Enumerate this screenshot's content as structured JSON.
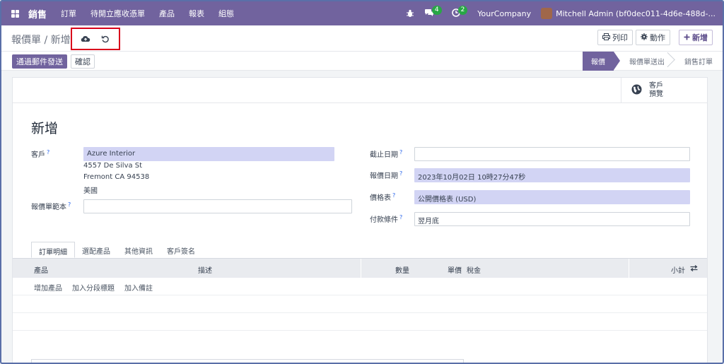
{
  "navbar": {
    "app_name": "銷售",
    "menu": [
      "訂單",
      "待開立應收憑單",
      "產品",
      "報表",
      "組態"
    ],
    "messages_count": "4",
    "activities_count": "2",
    "company": "YourCompany",
    "user": "Mitchell Admin (bf0dec011-4d6e-488d-..."
  },
  "breadcrumb": {
    "parent": "報價單",
    "separator": "/",
    "current": "新增"
  },
  "toolbar": {
    "print_label": "列印",
    "action_label": "動作",
    "new_label": "新增"
  },
  "actions": {
    "send_email_label": "通過郵件發送",
    "confirm_label": "確認"
  },
  "statusbar": {
    "stages": [
      "報價",
      "報價單送出",
      "銷售訂單"
    ],
    "active": "報價"
  },
  "smart_button": {
    "line1": "客戶",
    "line2": "預覽"
  },
  "form": {
    "title": "新增",
    "customer_label": "客戶",
    "customer_value": "Azure Interior",
    "address_line1": "4557 De Silva St",
    "address_line2": "Fremont CA 94538",
    "address_line3": "美國",
    "template_label": "報價單範本",
    "template_value": "",
    "expiry_label": "截止日期",
    "expiry_value": "",
    "quote_date_label": "報價日期",
    "quote_date_value": "2023年10月02日 10時27分47秒",
    "pricelist_label": "價格表",
    "pricelist_value": "公開價格表 (USD)",
    "payment_terms_label": "付款條件",
    "payment_terms_value": "翌月底",
    "help_mark": "?"
  },
  "tabs": [
    "訂單明細",
    "選配產品",
    "其他資訊",
    "客戶簽名"
  ],
  "table": {
    "headers": {
      "product": "產品",
      "description": "描述",
      "quantity": "數量",
      "unit_price": "單價",
      "taxes": "稅金",
      "subtotal": "小計"
    },
    "add_product": "增加產品",
    "add_section": "加入分段標題",
    "add_note": "加入備註"
  },
  "colors": {
    "brand": "#71639e",
    "highlight": "#d9001b",
    "required_field": "#d2d4f4"
  }
}
